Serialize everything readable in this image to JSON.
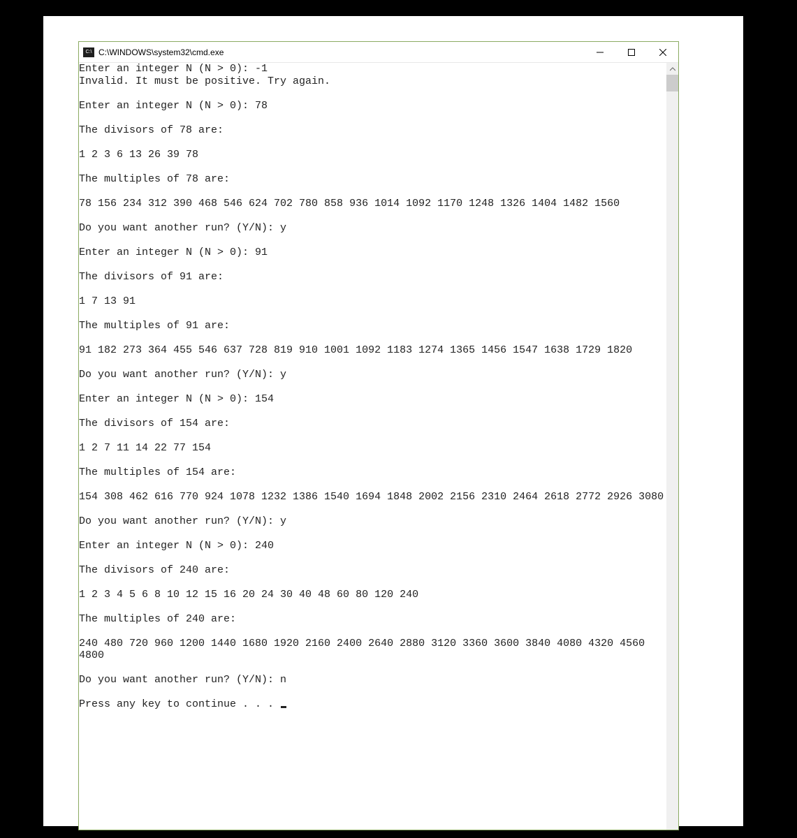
{
  "window": {
    "title": "C:\\WINDOWS\\system32\\cmd.exe"
  },
  "console": {
    "lines": [
      "Enter an integer N (N > 0): -1",
      "Invalid. It must be positive. Try again.",
      "",
      "Enter an integer N (N > 0): 78",
      "",
      "The divisors of 78 are:",
      "",
      "1 2 3 6 13 26 39 78",
      "",
      "The multiples of 78 are:",
      "",
      "78 156 234 312 390 468 546 624 702 780 858 936 1014 1092 1170 1248 1326 1404 1482 1560",
      "",
      "Do you want another run? (Y/N): y",
      "",
      "Enter an integer N (N > 0): 91",
      "",
      "The divisors of 91 are:",
      "",
      "1 7 13 91",
      "",
      "The multiples of 91 are:",
      "",
      "91 182 273 364 455 546 637 728 819 910 1001 1092 1183 1274 1365 1456 1547 1638 1729 1820",
      "",
      "Do you want another run? (Y/N): y",
      "",
      "Enter an integer N (N > 0): 154",
      "",
      "The divisors of 154 are:",
      "",
      "1 2 7 11 14 22 77 154",
      "",
      "The multiples of 154 are:",
      "",
      "154 308 462 616 770 924 1078 1232 1386 1540 1694 1848 2002 2156 2310 2464 2618 2772 2926 3080",
      "",
      "Do you want another run? (Y/N): y",
      "",
      "Enter an integer N (N > 0): 240",
      "",
      "The divisors of 240 are:",
      "",
      "1 2 3 4 5 6 8 10 12 15 16 20 24 30 40 48 60 80 120 240",
      "",
      "The multiples of 240 are:",
      "",
      "240 480 720 960 1200 1440 1680 1920 2160 2400 2640 2880 3120 3360 3600 3840 4080 4320 4560 4800",
      "",
      "Do you want another run? (Y/N): n",
      "",
      "Press any key to continue . . . "
    ]
  }
}
